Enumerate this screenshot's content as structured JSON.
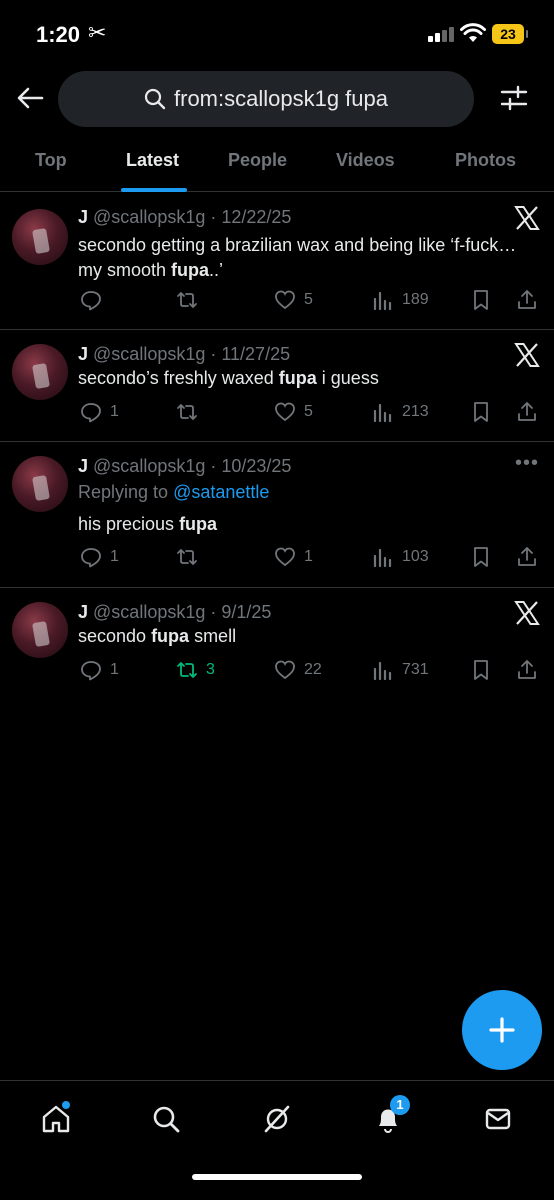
{
  "status_bar": {
    "time": "1:20",
    "battery": "23"
  },
  "search": {
    "query": "from:scallopsk1g fupa"
  },
  "tabs": [
    {
      "label": "Top",
      "active": false
    },
    {
      "label": "Latest",
      "active": true
    },
    {
      "label": "People",
      "active": false
    },
    {
      "label": "Videos",
      "active": false
    },
    {
      "label": "Photos",
      "active": false
    }
  ],
  "tweets": [
    {
      "author": "J",
      "handle": "@scallopsk1g",
      "date": "12/22/25",
      "text_before": "secondo getting a brazilian wax and being like ‘f-fuck… my smooth ",
      "bold": "fupa",
      "text_after": "..’",
      "replies": "",
      "retweets": "",
      "likes": "5",
      "views": "189",
      "corner": "x-logo"
    },
    {
      "author": "J",
      "handle": "@scallopsk1g",
      "date": "11/27/25",
      "text_before": "secondo’s freshly waxed ",
      "bold": "fupa",
      "text_after": " i guess",
      "replies": "1",
      "retweets": "",
      "likes": "5",
      "views": "213",
      "corner": "x-logo"
    },
    {
      "author": "J",
      "handle": "@scallopsk1g",
      "date": "10/23/25",
      "reply_prefix": "Replying to ",
      "reply_to": "@satanettle",
      "text_before": "his precious ",
      "bold": "fupa",
      "text_after": "",
      "replies": "1",
      "retweets": "",
      "likes": "1",
      "views": "103",
      "corner": "more"
    },
    {
      "author": "J",
      "handle": "@scallopsk1g",
      "date": "9/1/25",
      "text_before": "secondo ",
      "bold": "fupa",
      "text_after": " smell",
      "replies": "1",
      "retweets": "3",
      "likes": "22",
      "views": "731",
      "corner": "x-logo",
      "retweeted": true
    }
  ],
  "notifications_badge": "1",
  "colors": {
    "accent": "#1d9bf0",
    "retweet": "#00ba7c",
    "muted": "#71767b",
    "background": "#000000"
  }
}
